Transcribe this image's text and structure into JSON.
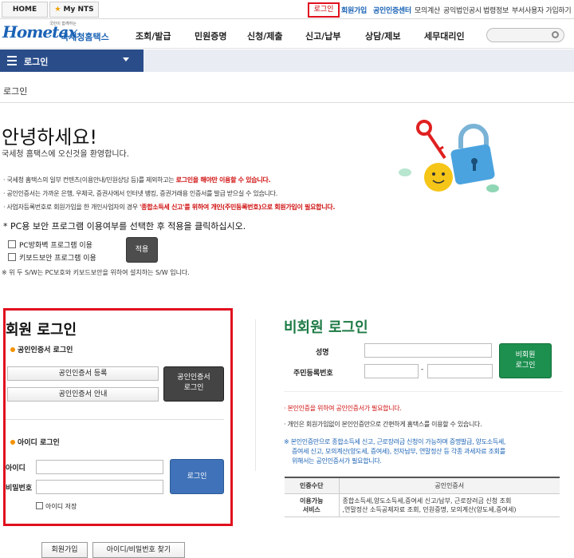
{
  "topbar": {
    "home": "HOME",
    "mynts": "My NTS",
    "utils": [
      "로그인",
      "회원가입",
      "공인인증센터",
      "모의계산",
      "공익법인공시",
      "법령정보",
      "부서사용자 가입하기"
    ]
  },
  "gnb": {
    "logo": "Hometax",
    "logo_tag": "국민이 함께하는",
    "logo_nts": "국세청홈택스",
    "menus": [
      "조회/발급",
      "민원증명",
      "신청/제출",
      "신고/납부",
      "상담/제보",
      "세무대리인"
    ]
  },
  "location": {
    "label": "로그인"
  },
  "page": {
    "title": "로그인",
    "greeting": "안녕하세요!",
    "welcome": "국세청 홈택스에 오신것을 환영합니다.",
    "notices": [
      {
        "pre": "· 국세청 홈택스의 일부 컨텐츠(이용안내/민원상담 등)를 제외하고는 ",
        "red": "로그인을 해야만 이용할 수 있습니다.",
        "post": ""
      },
      {
        "pre": "· 공인인증서는 가까운 은행, 우체국, 증권사에서 인터넷 뱅킹, 증권거래용 인증서를 발급 받으실 수 있습니다.",
        "red": "",
        "post": ""
      },
      {
        "pre": "· 사업자등록번호로 회원가입을 한 개인사업자의 경우 ",
        "red": "'종합소득세 신고'를 위하여 개인(주민등록번호)으로 회원가입이 필요합니다.",
        "post": ""
      }
    ],
    "security_question": "* PC용 보안 프로그램 이용여부를 선택한 후 적용을 클릭하십시오.",
    "checkboxes": [
      "PC방화벽 프로그램 이용",
      "키보드보안 프로그램 이용"
    ],
    "apply": "적용",
    "sw_note": "※ 위 두 S/W는 PC보호와 키보드보안을 위하여 설치하는 S/W 입니다."
  },
  "member": {
    "title": "회원 로그인",
    "cert_heading": "공인인증서 로그인",
    "cert_register": "공인인증서 등록",
    "cert_guide": "공인인증서 안내",
    "cert_login_line1": "공인인증서",
    "cert_login_line2": "로그인",
    "id_heading": "아이디 로그인",
    "id_label": "아이디",
    "pw_label": "비밀번호",
    "login": "로그인",
    "save_id": "아이디 저장"
  },
  "guest": {
    "title": "비회원 로그인",
    "name_label": "성명",
    "rrn_label": "주민등록번호",
    "btn_line1": "비회원",
    "btn_line2": "로그인",
    "note1": "· 본인인증을 위하여 공인인증서가 필요합니다.",
    "note2": "· 개인은 회원가입없이 본인인증만으로 간편하게 홈택스를 이용할 수 있습니다.",
    "note3a": "※ 본인인증만으로 종합소득세 신고, 근로장려금 신청이 가능하며 증명발급, 양도소득세,",
    "note3b": "증여세 신고, 모의계산(양도세, 증여세), 전자납부, 연말정산 등 각종 과세자료 조회를",
    "note3c": "위해서는 공인인증서가 필요합니다.",
    "table_head": [
      "인증수단",
      "공인인증서"
    ],
    "table_row1": "이용가능",
    "table_row2": "서비스",
    "table_desc1": "종합소득세,양도소득세,증여세 신고/납부, 근로장려금 신청 조회",
    "table_desc2": ",연말정산 소득공제자료 조회, 민원증명, 모의계산(양도세,증여세)"
  },
  "bottom": [
    "회원가입",
    "아이디/비밀번호 찾기"
  ],
  "colors": {
    "accent_red": "#e0101e",
    "nav_blue": "#2a4d8a",
    "guest_green": "#1d7a45"
  }
}
